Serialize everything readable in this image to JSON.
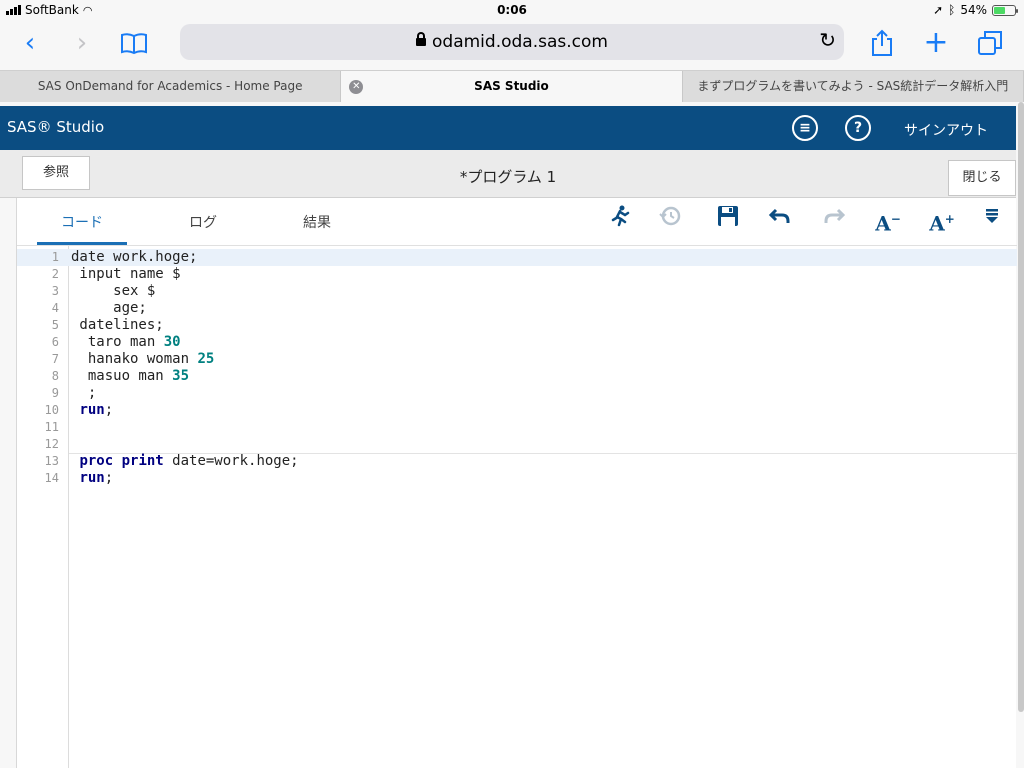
{
  "status": {
    "carrier": "SoftBank",
    "time": "0:06",
    "battery": "54%",
    "battery_level": 0.54
  },
  "safari": {
    "host": "odamid.oda.sas.com",
    "tabs": [
      {
        "label": "SAS OnDemand for Academics - Home Page"
      },
      {
        "label": "SAS Studio"
      },
      {
        "label": "まずプログラムを書いてみよう - SAS統計データ解析入門"
      }
    ]
  },
  "sas": {
    "brand": "SAS® Studio",
    "signout": "サインアウト",
    "browse_button": "参照",
    "program_title": "*プログラム 1",
    "close_button": "閉じる",
    "subtabs": {
      "code": "コード",
      "log": "ログ",
      "results": "結果"
    },
    "tool_glyphs": {
      "font_decrease": "A",
      "font_increase": "A"
    },
    "help_glyph": "?"
  },
  "code_lines": [
    {
      "n": "1",
      "parts": [
        [
          "t",
          "date work.hoge;"
        ]
      ]
    },
    {
      "n": "2",
      "parts": [
        [
          "t",
          " input name $"
        ]
      ]
    },
    {
      "n": "3",
      "parts": [
        [
          "t",
          "     sex $"
        ]
      ]
    },
    {
      "n": "4",
      "parts": [
        [
          "t",
          "     age;"
        ]
      ]
    },
    {
      "n": "5",
      "parts": [
        [
          "t",
          " datelines;"
        ]
      ]
    },
    {
      "n": "6",
      "parts": [
        [
          "t",
          "  taro man "
        ],
        [
          "n",
          "30"
        ]
      ]
    },
    {
      "n": "7",
      "parts": [
        [
          "t",
          "  hanako woman "
        ],
        [
          "n",
          "25"
        ]
      ]
    },
    {
      "n": "8",
      "parts": [
        [
          "t",
          "  masuo man "
        ],
        [
          "n",
          "35"
        ]
      ]
    },
    {
      "n": "9",
      "parts": [
        [
          "t",
          "  ;"
        ]
      ]
    },
    {
      "n": "10",
      "parts": [
        [
          "t",
          " "
        ],
        [
          "k",
          "run"
        ],
        [
          "t",
          ";"
        ]
      ]
    },
    {
      "n": "11",
      "parts": []
    },
    {
      "n": "12",
      "parts": []
    },
    {
      "n": "13",
      "parts": [
        [
          "t",
          " "
        ],
        [
          "k",
          "proc print"
        ],
        [
          "t",
          " date=work.hoge;"
        ]
      ]
    },
    {
      "n": "14",
      "parts": [
        [
          "t",
          " "
        ],
        [
          "k",
          "run"
        ],
        [
          "t",
          ";"
        ]
      ]
    }
  ],
  "icons": [
    "signal-icon",
    "wifi-icon",
    "location-icon",
    "bluetooth-icon",
    "battery-icon",
    "back-icon",
    "forward-icon",
    "bookmarks-icon",
    "lock-icon",
    "reload-icon",
    "share-icon",
    "new-tab-icon",
    "tabs-icon",
    "tab-close-icon",
    "menu-icon",
    "help-icon",
    "run-icon",
    "history-icon",
    "save-icon",
    "undo-icon",
    "redo-icon",
    "font-decrease-icon",
    "font-increase-icon",
    "more-icon"
  ]
}
